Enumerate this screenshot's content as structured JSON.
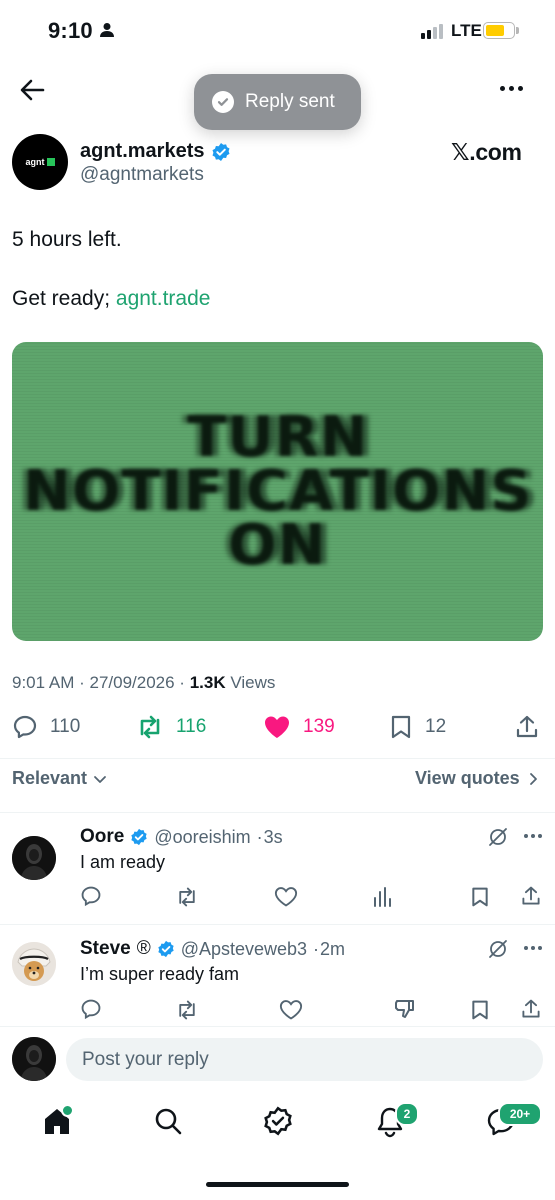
{
  "status_bar": {
    "time": "9:10",
    "network": "LTE"
  },
  "toast": {
    "text": "Reply sent"
  },
  "tweet": {
    "author_name": "agnt.markets",
    "author_handle": "@agntmarkets",
    "avatar_text": "agnt",
    "source_badge": "𝕏.com",
    "line1": "5 hours left.",
    "line2_prefix": "Get ready; ",
    "link": "agnt.trade",
    "media_lines": [
      "TURN",
      "NOTIFICATIONS",
      "ON"
    ],
    "time": "9:01 AM",
    "date": "27/09/2026",
    "views_count": "1.3K",
    "views_label": "Views",
    "replies": "110",
    "reposts": "116",
    "likes": "139",
    "bookmarks": "12"
  },
  "filters": {
    "sort": "Relevant",
    "quotes": "View quotes"
  },
  "replies": [
    {
      "name": "Oore",
      "handle": "@ooreishim",
      "time": "3s",
      "text": "I am ready"
    },
    {
      "name": "Steve",
      "name_badge": "®",
      "handle": "@Apsteveweb3",
      "time": "2m",
      "text": "I’m super ready fam"
    }
  ],
  "composer": {
    "placeholder": "Post your reply"
  },
  "nav": {
    "notifications_badge": "2",
    "messages_badge": "20+"
  },
  "colors": {
    "accent": "#1fa370",
    "like": "#f91880",
    "verified": "#1d9bf0",
    "muted": "#536471",
    "media_bg": "#5ea56c"
  }
}
